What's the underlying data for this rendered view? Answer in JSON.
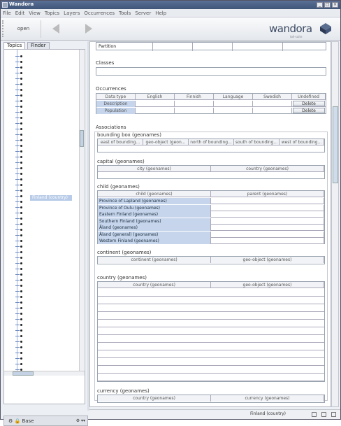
{
  "window": {
    "title": "Wandora"
  },
  "menu": [
    "File",
    "Edit",
    "View",
    "Topics",
    "Layers",
    "Occurrences",
    "Tools",
    "Server",
    "Help"
  ],
  "toolbar": {
    "open_label": "open"
  },
  "logo": {
    "name": "wandora",
    "tagline": "toll-suite"
  },
  "left": {
    "tabs": [
      "Topics",
      "Finder"
    ],
    "selected_node": "Finland (country)",
    "dock_label": "Base"
  },
  "panel": {
    "partial_label": "Partition",
    "classes_title": "Classes",
    "occurrences": {
      "title": "Occurrences",
      "headers": [
        "Data type",
        "English",
        "Finnish",
        "Language",
        "Swedish",
        "Undefined"
      ],
      "rows": [
        [
          "Description",
          " ",
          " ",
          " ",
          " ",
          "Delete"
        ],
        [
          "Population",
          " ",
          " ",
          " ",
          " ",
          "Delete"
        ]
      ]
    },
    "associations_title": "Associations",
    "bounding": {
      "title": "bounding box (geonames)",
      "headers": [
        "east of bounding...",
        "geo-object (geon...",
        "north of bounding...",
        "south of bounding...",
        "west of bounding..."
      ]
    },
    "capital": {
      "title": "capital (geonames)",
      "headers": [
        "city (geonames)",
        "country (geonames)"
      ]
    },
    "child": {
      "title": "child (geonames)",
      "headers": [
        "child (geonames)",
        "parent (geonames)"
      ],
      "rows": [
        "Province of Lapland (geonames)",
        "Province of Oulu (geonames)",
        "Eastern Finland (geonames)",
        "Southern Finland (geonames)",
        "Åland (geonames)",
        "Åland (general) (geonames)",
        "Western Finland (geonames)"
      ]
    },
    "continent": {
      "title": "continent (geonames)",
      "headers": [
        "continent (geonames)",
        "geo-object (geonames)"
      ]
    },
    "country": {
      "title": "country (geonames)",
      "headers": [
        "country (geonames)",
        "geo-object (geonames)"
      ]
    },
    "currency": {
      "title": "currency (geonames)",
      "headers": [
        "country (geonames)",
        "currency (geonames)"
      ]
    }
  },
  "status": {
    "text": "Finland (country)"
  }
}
